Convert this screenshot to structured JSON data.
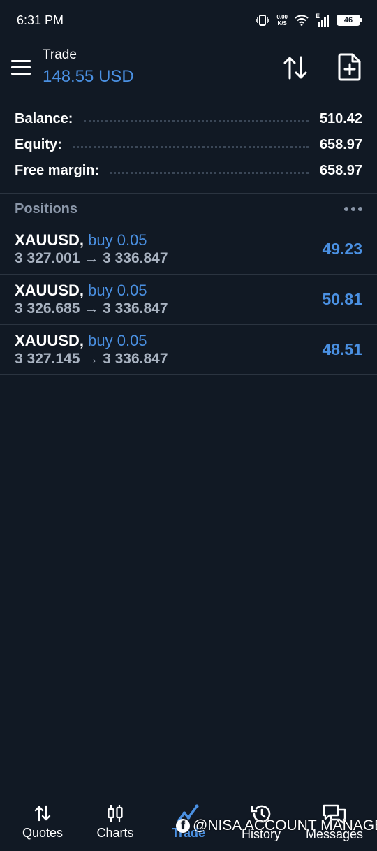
{
  "status_bar": {
    "time": "6:31 PM",
    "net_speed_value": "0.00",
    "net_speed_unit": "K/S",
    "network_label": "E",
    "battery": "46"
  },
  "header": {
    "title": "Trade",
    "subtitle": "148.55 USD"
  },
  "account": [
    {
      "label": "Balance:",
      "value": "510.42"
    },
    {
      "label": "Equity:",
      "value": "658.97"
    },
    {
      "label": "Free margin:",
      "value": "658.97"
    }
  ],
  "positions": {
    "title": "Positions",
    "items": [
      {
        "symbol": "XAUUSD,",
        "side": "buy 0.05",
        "prices": "3 327.001 → 3 336.847",
        "profit": "49.23"
      },
      {
        "symbol": "XAUUSD,",
        "side": "buy 0.05",
        "prices": "3 326.685 → 3 336.847",
        "profit": "50.81"
      },
      {
        "symbol": "XAUUSD,",
        "side": "buy 0.05",
        "prices": "3 327.145 → 3 336.847",
        "profit": "48.51"
      }
    ]
  },
  "nav": [
    {
      "label": "Quotes",
      "icon": "quotes-icon"
    },
    {
      "label": "Charts",
      "icon": "charts-icon"
    },
    {
      "label": "Trade",
      "icon": "trade-icon",
      "active": true
    },
    {
      "label": "History",
      "icon": "history-icon"
    },
    {
      "label": "Messages",
      "icon": "messages-icon"
    }
  ],
  "watermark": {
    "text": "@NISA ACCOUNT MANAGER"
  },
  "colors": {
    "background": "#111924",
    "accent": "#4a90e2",
    "muted": "#8a96a8"
  }
}
